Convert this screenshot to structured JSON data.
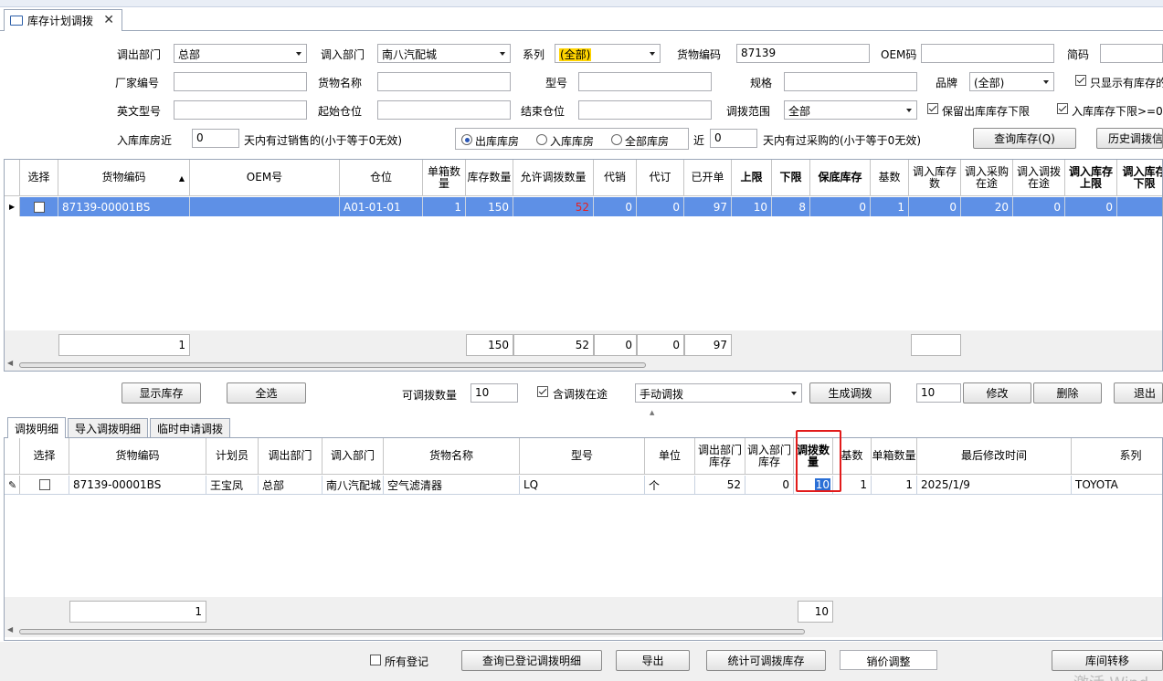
{
  "window": {
    "tab_title": "库存计划调拨"
  },
  "filters": {
    "out_dept_label": "调出部门",
    "out_dept_value": "总部",
    "in_dept_label": "调入部门",
    "in_dept_value": "南八汽配城",
    "series_label": "系列",
    "series_value": "(全部)",
    "code_label": "货物编码",
    "code_value": "87139",
    "oem_label": "OEM码",
    "short_label": "简码",
    "maker_label": "厂家编号",
    "name_label": "货物名称",
    "model_label": "型号",
    "spec_label": "规格",
    "brand_label": "品牌",
    "brand_value": "(全部)",
    "only_stock_label": "只显示有库存的",
    "en_model_label": "英文型号",
    "start_loc_label": "起始仓位",
    "end_loc_label": "结束仓位",
    "range_label": "调拨范围",
    "range_value": "全部",
    "keep_min_label": "保留出库库存下限",
    "in_min_label": "入库库存下限>=0",
    "recent_label": "入库库房近",
    "recent_days": "0",
    "recent_sales_label": "天内有过销售的(小于等于0无效)",
    "radio_out": "出库库房",
    "radio_in": "入库库房",
    "radio_all": "全部库房",
    "near_label": "近",
    "near_days": "0",
    "near_purchase_label": "天内有过采购的(小于等于0无效)",
    "query_stock_btn": "查询库存(Q)",
    "history_btn": "历史调拨信"
  },
  "grid1": {
    "headers": [
      "选择",
      "货物编码",
      "OEM号",
      "仓位",
      "单箱数量",
      "库存数量",
      "允许调拨数量",
      "代销",
      "代订",
      "已开单",
      "上限",
      "下限",
      "保底库存",
      "基数",
      "调入库存数",
      "调入采购在途",
      "调入调拨在途",
      "调入库存上限",
      "调入库存下限"
    ],
    "row": {
      "code": "87139-00001BS",
      "oem": "",
      "loc": "A01-01-01",
      "box": "1",
      "stock": "150",
      "allow": "52",
      "consign": "0",
      "order": "0",
      "opened": "97",
      "upper": "10",
      "lower": "8",
      "guarantee": "0",
      "base": "1",
      "in_stock": "0",
      "in_purchase": "20",
      "in_transfer": "0",
      "in_upper": "0"
    },
    "footer": {
      "count": "1",
      "stock": "150",
      "allow": "52",
      "consign": "0",
      "order": "0",
      "opened": "97"
    }
  },
  "controls": {
    "show_stock_btn": "显示库存",
    "select_all_btn": "全选",
    "transferable_label": "可调拨数量",
    "transferable_value": "10",
    "include_transit_label": "含调拨在途",
    "mode_value": "手动调拨",
    "generate_btn": "生成调拨",
    "qty_value": "10",
    "modify_btn": "修改",
    "delete_btn": "删除",
    "exit_btn": "退出"
  },
  "subtabs": [
    "调拨明细",
    "导入调拨明细",
    "临时申请调拨"
  ],
  "grid2": {
    "headers": [
      "选择",
      "货物编码",
      "计划员",
      "调出部门",
      "调入部门",
      "货物名称",
      "型号",
      "单位",
      "调出部门库存",
      "调入部门库存",
      "调拨数量",
      "基数",
      "单箱数量",
      "最后修改时间",
      "系列"
    ],
    "row": {
      "code": "87139-00001BS",
      "planner": "王宝凤",
      "out": "总部",
      "in": "南八汽配城",
      "name": "空气滤清器",
      "model": "LQ",
      "unit": "个",
      "out_stock": "52",
      "in_stock": "0",
      "qty": "10",
      "base": "1",
      "box": "1",
      "modified": "2025/1/9",
      "series": "TOYOTA"
    },
    "footer": {
      "count": "1",
      "qty": "10"
    }
  },
  "bottom": {
    "all_reg_label": "所有登记",
    "query_reg_btn": "查询已登记调拨明细",
    "export_btn": "导出",
    "stat_btn": "统计可调拨库存",
    "price_adjust": "销价调整",
    "transfer_btn": "库间转移",
    "watermark": "激活 Wind"
  }
}
